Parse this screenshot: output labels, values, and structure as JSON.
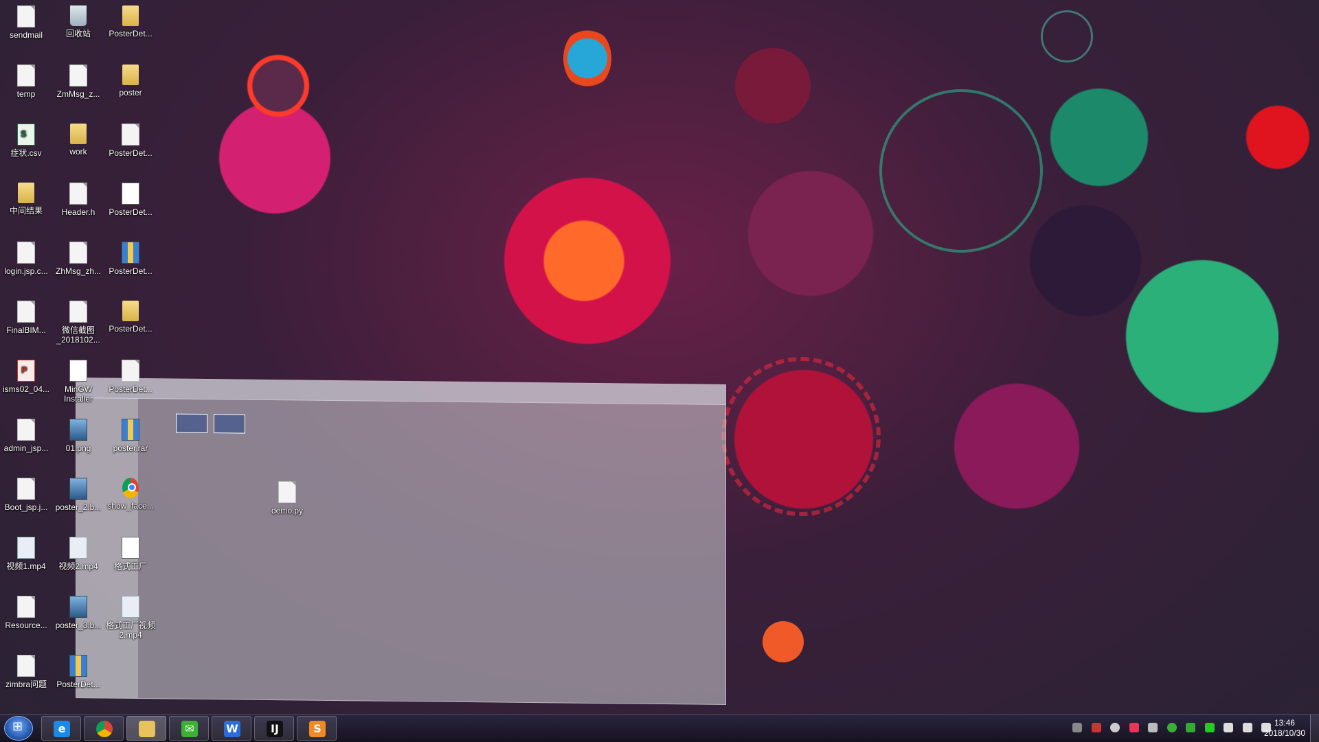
{
  "desktop": {
    "icons": [
      {
        "label": "sendmail",
        "type": "file"
      },
      {
        "label": "回收站",
        "type": "recycle"
      },
      {
        "label": "PosterDet...",
        "type": "folder"
      },
      {
        "label": "temp",
        "type": "file"
      },
      {
        "label": "ZmMsg_z...",
        "type": "file"
      },
      {
        "label": "poster",
        "type": "folder"
      },
      {
        "label": "症状.csv",
        "type": "excel"
      },
      {
        "label": "work",
        "type": "folder"
      },
      {
        "label": "PosterDet...",
        "type": "file"
      },
      {
        "label": "中间结果",
        "type": "folder"
      },
      {
        "label": "Header.h",
        "type": "file"
      },
      {
        "label": "PosterDet...",
        "type": "exe"
      },
      {
        "label": "login.jsp.c...",
        "type": "file"
      },
      {
        "label": "ZhMsg_zh...",
        "type": "file"
      },
      {
        "label": "PosterDet...",
        "type": "zip"
      },
      {
        "label": "FinalBIM...",
        "type": "file"
      },
      {
        "label": "微信截图_2018102...",
        "type": "file"
      },
      {
        "label": "PosterDet...",
        "type": "folder"
      },
      {
        "label": "isms02_04...",
        "type": "ppt"
      },
      {
        "label": "MinGW Installer",
        "type": "exe"
      },
      {
        "label": "PosterDet...",
        "type": "file"
      },
      {
        "label": "admin_jsp...",
        "type": "file"
      },
      {
        "label": "01.png",
        "type": "img"
      },
      {
        "label": "poster.rar",
        "type": "zip"
      },
      {
        "label": "Boot_jsp.j...",
        "type": "file"
      },
      {
        "label": "poster_2.b...",
        "type": "img"
      },
      {
        "label": "show_face...",
        "type": "chrome"
      },
      {
        "label": "视频1.mp4",
        "type": "video"
      },
      {
        "label": "视频2.mp4",
        "type": "video"
      },
      {
        "label": "格式工厂",
        "type": "exe"
      },
      {
        "label": "Resource...",
        "type": "file"
      },
      {
        "label": "poster_3.b...",
        "type": "img"
      },
      {
        "label": "格式工厂视频2.mp4",
        "type": "video"
      },
      {
        "label": "zimbra问题",
        "type": "file"
      },
      {
        "label": "PosterDet...",
        "type": "zip"
      }
    ],
    "extra_icon": {
      "label": "demo.py",
      "type": "file"
    }
  },
  "taskbar": {
    "apps": [
      {
        "name": "ie",
        "glyph": "e",
        "color": "#1e88e5"
      },
      {
        "name": "chrome",
        "glyph": "",
        "color": ""
      },
      {
        "name": "file-explorer",
        "glyph": "",
        "color": "#e8c25a"
      },
      {
        "name": "wechat",
        "glyph": "✉",
        "color": "#3cb034"
      },
      {
        "name": "wps-writer",
        "glyph": "W",
        "color": "#2a6dd9"
      },
      {
        "name": "intellij",
        "glyph": "IJ",
        "color": "#111111"
      },
      {
        "name": "sublime",
        "glyph": "S",
        "color": "#f08a24"
      }
    ],
    "active_app": "file-explorer",
    "clock": {
      "time": "13:46",
      "date": "2018/10/30"
    }
  }
}
